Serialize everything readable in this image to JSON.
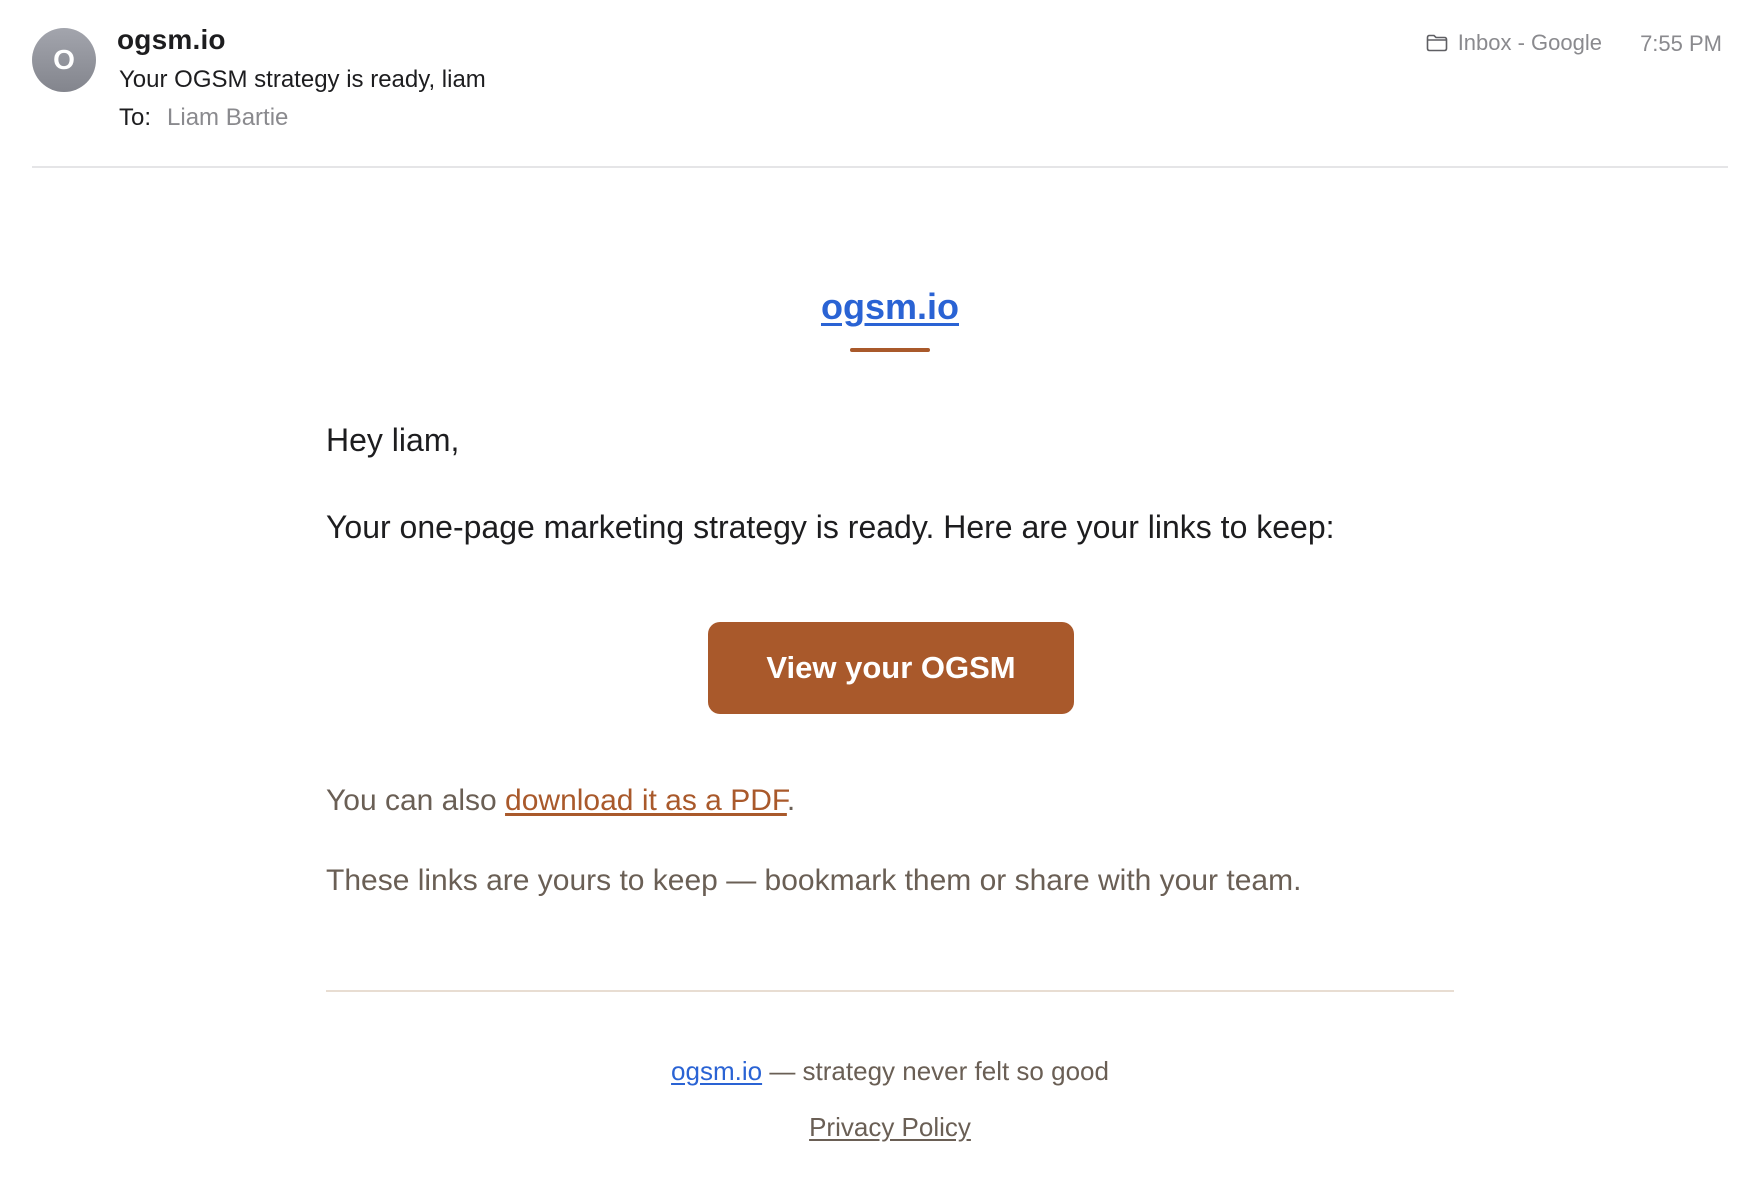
{
  "header": {
    "avatar_initial": "O",
    "sender": "ogsm.io",
    "subject": "Your OGSM strategy is ready, liam",
    "to_label": "To:",
    "to_value": "Liam Bartie",
    "mailbox": "Inbox - Google",
    "mailbox_icon": "folder-icon",
    "time": "7:55 PM"
  },
  "body": {
    "brand": "ogsm.io",
    "greeting": "Hey liam,",
    "intro": "Your one-page marketing strategy is ready. Here are your links to keep:",
    "cta_label": "View your OGSM",
    "pdf_prefix": "You can also ",
    "pdf_link": "download it as a PDF",
    "pdf_suffix": ".",
    "keep_note": "These links are yours to keep — bookmark them or share with your team."
  },
  "footer": {
    "brand_link": "ogsm.io",
    "tagline": " — strategy never felt so good",
    "privacy": "Privacy Policy"
  },
  "colors": {
    "accent": "#a9592b",
    "link": "#2a63d4",
    "muted_text": "#6a5f55"
  }
}
